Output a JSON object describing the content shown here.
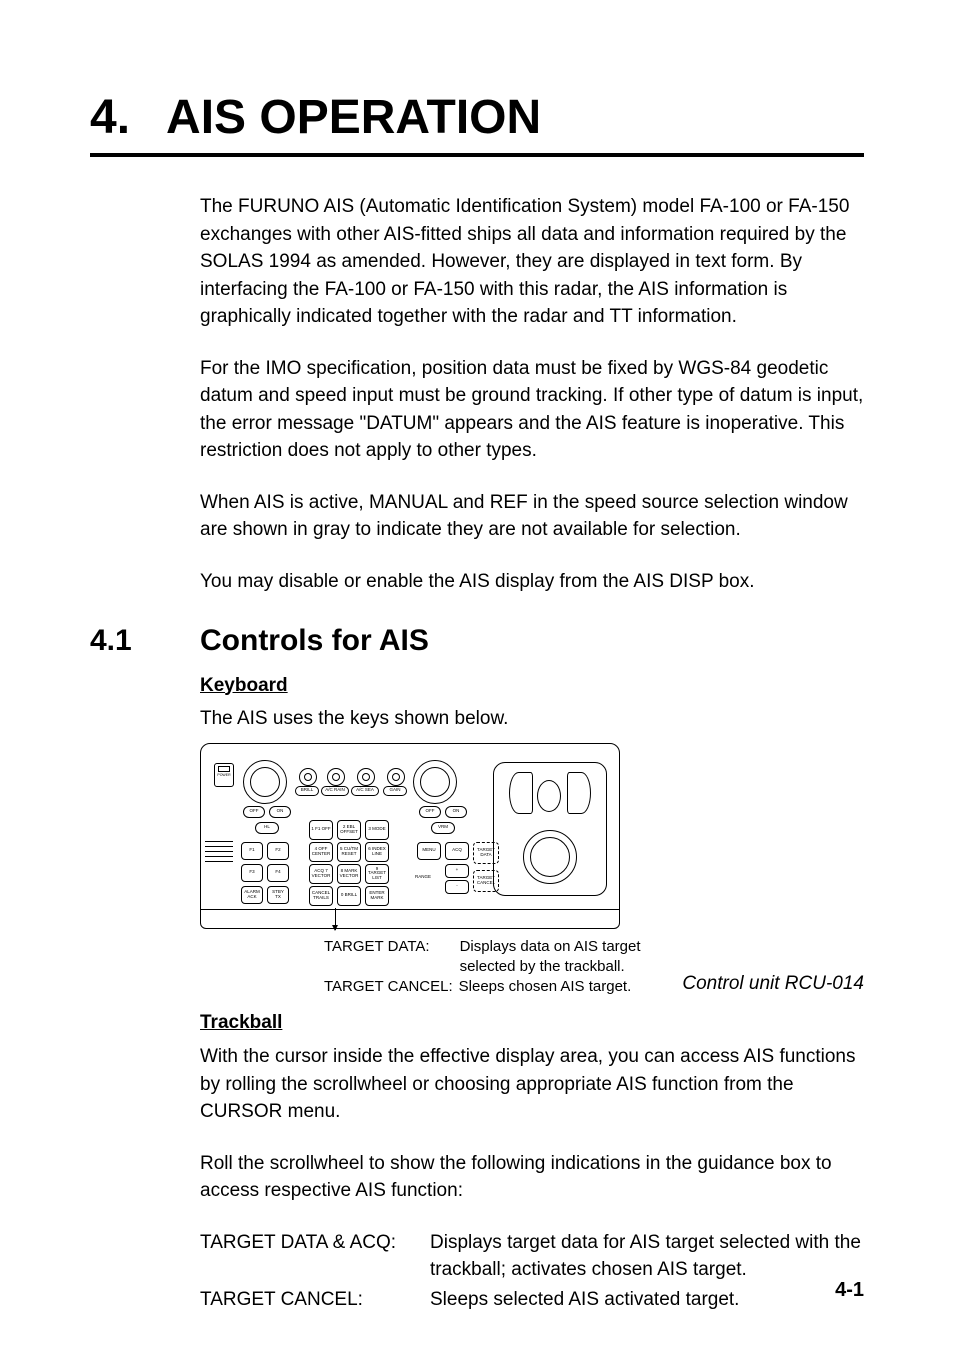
{
  "chapter": {
    "number": "4.",
    "title": "AIS OPERATION"
  },
  "intro": {
    "p1": "The FURUNO AIS (Automatic Identification System) model FA-100 or FA-150 exchanges with other AIS-fitted ships all data and information required by the SOLAS 1994 as amended. However, they are displayed in text form. By interfacing the FA-100 or FA-150 with this radar, the AIS information is graphically indicated together with the radar and TT information.",
    "p2": "For the IMO specification, position data must be fixed by WGS-84 geodetic datum and speed input must be ground tracking. If other type of datum is input, the error message \"DATUM\" appears and the AIS feature is inoperative. This restriction does not apply to other types.",
    "p3": "When AIS is active, MANUAL and REF in the speed source selection window are shown in gray to indicate they are not available for selection.",
    "p4": "You may disable or enable the AIS display from the AIS DISP box."
  },
  "section": {
    "number": "4.1",
    "title": "Controls for AIS"
  },
  "keyboard": {
    "heading": "Keyboard",
    "lead": "The AIS uses the keys shown below.",
    "caption_target_data_label": "TARGET DATA:",
    "caption_target_data_text": "Displays data on AIS target selected by the trackball.",
    "caption_target_cancel_label": "TARGET CANCEL:",
    "caption_target_cancel_text": "Sleeps chosen AIS target.",
    "figure_title": "Control unit RCU-014",
    "knob_labels": [
      "BRILL",
      "A/C RAIN",
      "A/C SEA",
      "GAIN"
    ],
    "pill_labels_left": [
      "OFF",
      "ON",
      "HL"
    ],
    "pill_labels_right": [
      "OFF",
      "ON",
      "VRM"
    ],
    "fkeys": [
      "F1",
      "F2",
      "F3",
      "F4"
    ],
    "left_keys": [
      "ALARM ACK",
      "STBY TX"
    ],
    "grid": [
      [
        "1 F1 OFF",
        "2 EBL OFFSET",
        "3 MODE"
      ],
      [
        "4 OFF CENTER",
        "5 CU/TM RESET",
        "6 INDEX LINE"
      ],
      [
        "ACQ 7 VECTOR",
        "8 MARK VECTOR",
        "9 TARGET LIST"
      ],
      [
        "CANCEL TRAILS",
        "0 BRILL",
        "ENTER MARK"
      ]
    ],
    "right_col": [
      "MENU",
      "ACQ",
      "RANGE",
      "+",
      "-",
      "TARGET DATA",
      "TARGET CANCEL"
    ]
  },
  "trackball": {
    "heading": "Trackball",
    "p1": "With the cursor inside the effective display area, you can access AIS functions by rolling the scrollwheel or choosing appropriate AIS function from the CURSOR menu.",
    "p2": "Roll the scrollwheel to show the following indications in the guidance box to access respective AIS function:",
    "defs": [
      {
        "term": "TARGET DATA & ACQ:",
        "desc": "Displays target data for AIS target selected with the trackball; activates chosen AIS target."
      },
      {
        "term": "TARGET CANCEL:",
        "desc": "Sleeps selected AIS activated target."
      }
    ]
  },
  "page_number": "4-1"
}
